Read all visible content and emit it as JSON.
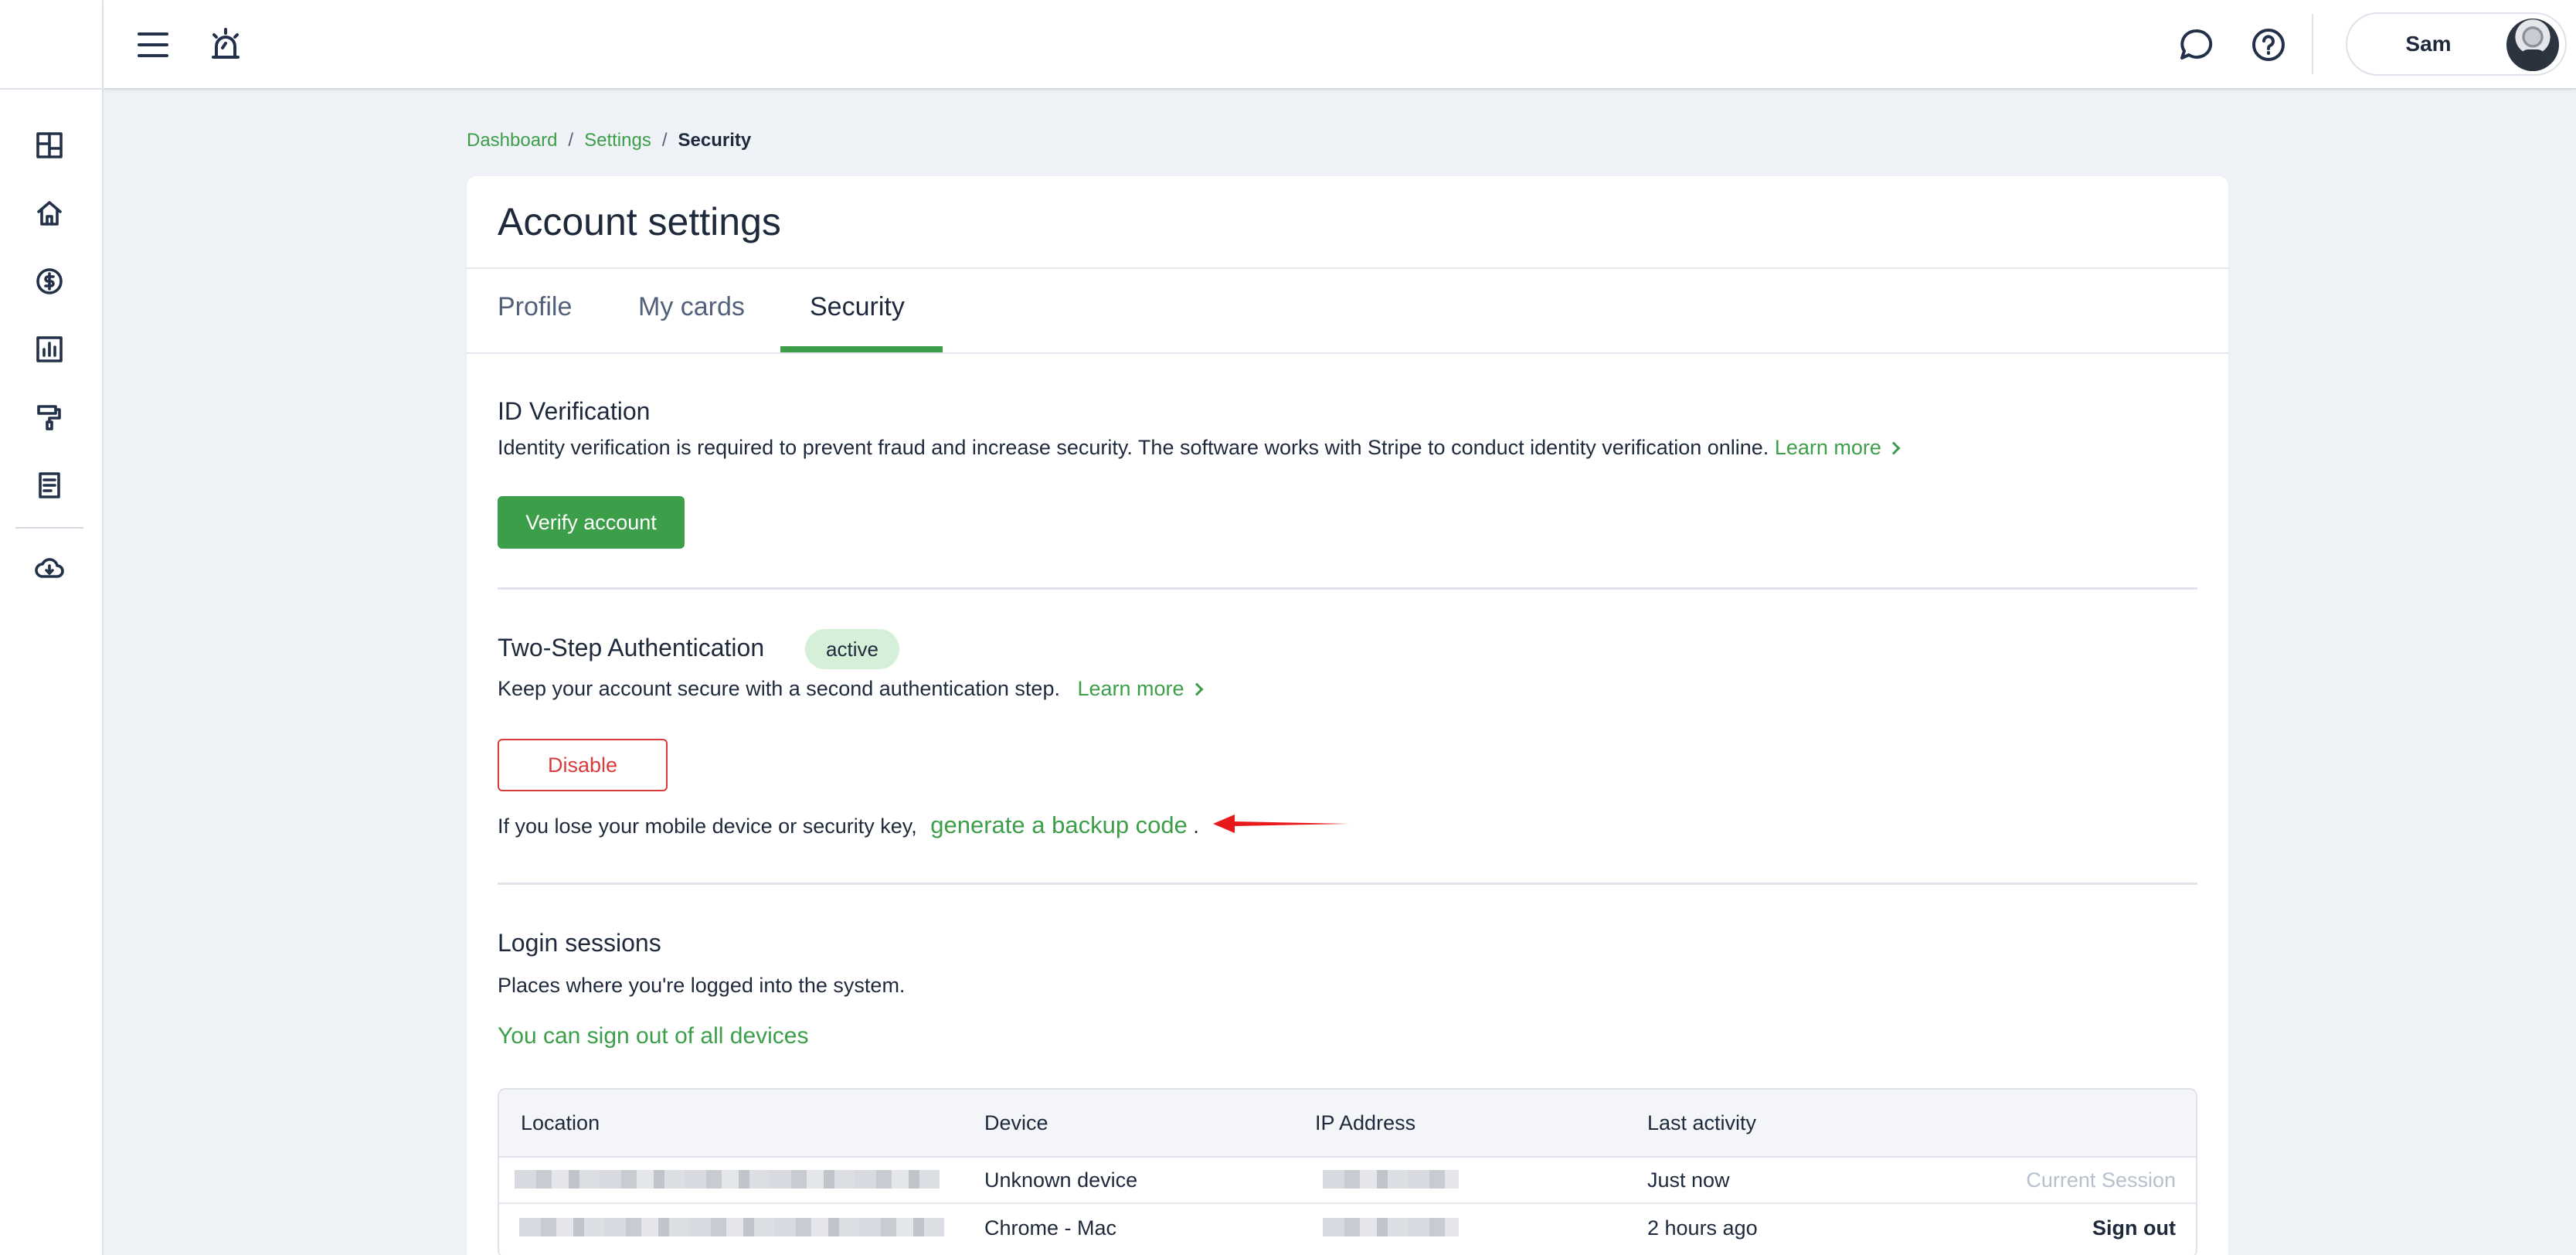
{
  "header": {
    "user_name": "Sam"
  },
  "breadcrumb": {
    "items": [
      "Dashboard",
      "Settings"
    ],
    "current": "Security",
    "separator": "/"
  },
  "page": {
    "title": "Account settings",
    "tabs": [
      {
        "label": "Profile",
        "active": false
      },
      {
        "label": "My cards",
        "active": false
      },
      {
        "label": "Security",
        "active": true
      }
    ]
  },
  "id_verification": {
    "title": "ID Verification",
    "description": "Identity verification is required to prevent fraud and increase security. The software works with Stripe to conduct identity verification online.",
    "learn_more": "Learn more",
    "button": "Verify account"
  },
  "two_step": {
    "title": "Two-Step Authentication",
    "status": "active",
    "description": "Keep your account secure with a second authentication step.",
    "learn_more": "Learn more",
    "disable_button": "Disable",
    "backup_text": "If you lose your mobile device or security key,",
    "backup_link": "generate a backup code",
    "backup_suffix": "."
  },
  "login_sessions": {
    "title": "Login sessions",
    "description": "Places where you're logged into the system.",
    "sign_out_all": "You can sign out of all devices",
    "columns": [
      "Location",
      "Device",
      "IP Address",
      "Last activity"
    ],
    "rows": [
      {
        "device": "Unknown device",
        "last_activity": "Just now",
        "action": "Current Session"
      },
      {
        "device": "Chrome - Mac",
        "last_activity": "2 hours ago",
        "action": "Sign out"
      }
    ]
  },
  "colors": {
    "accent": "#3d9e4a",
    "danger": "#d93a3a",
    "badge_bg": "#d6efd9",
    "annotation_arrow": "#e8191b"
  },
  "icons": {
    "sidebar": [
      "dashboard-grid-icon",
      "home-icon",
      "dollar-coin-icon",
      "bar-chart-icon",
      "paint-roller-icon",
      "document-icon",
      "cloud-download-icon"
    ],
    "header": [
      "menu-icon",
      "alarm-icon",
      "chat-icon",
      "help-icon"
    ]
  }
}
